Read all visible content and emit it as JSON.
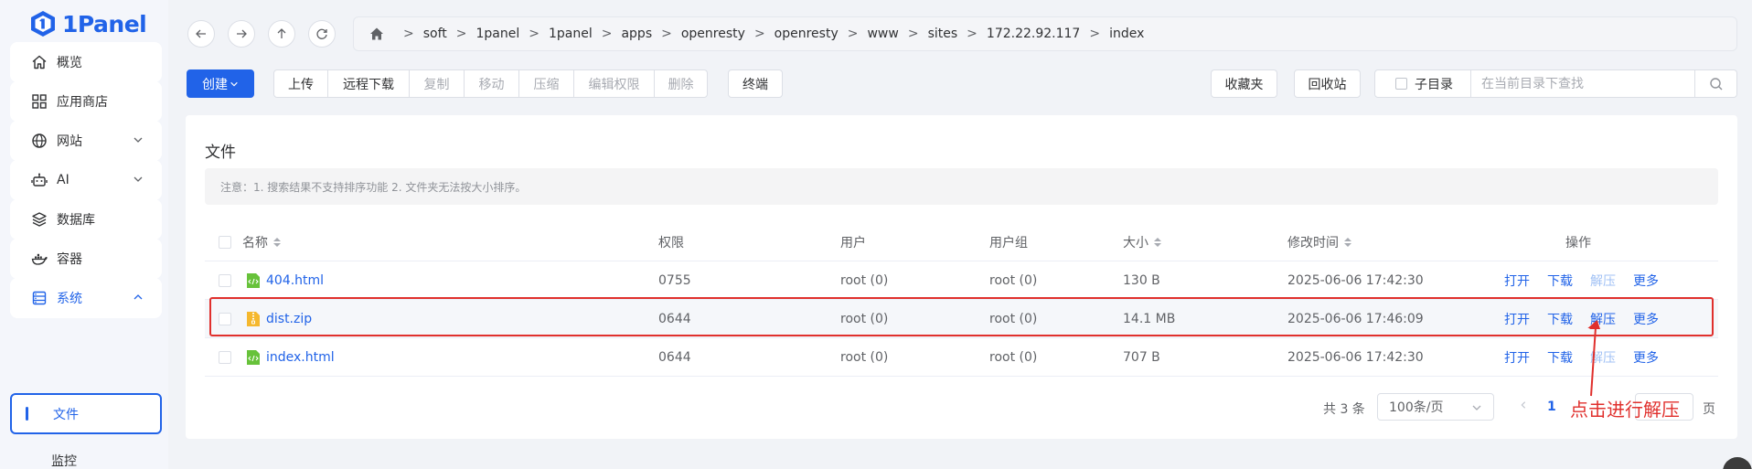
{
  "app": {
    "name": "1Panel",
    "brand_color": "#2163e8"
  },
  "sidebar": {
    "items": [
      {
        "label": "概览",
        "icon": "home-icon"
      },
      {
        "label": "应用商店",
        "icon": "grid-icon"
      },
      {
        "label": "网站",
        "icon": "globe-icon",
        "expandable": true
      },
      {
        "label": "AI",
        "icon": "robot-icon",
        "expandable": true
      },
      {
        "label": "数据库",
        "icon": "layers-icon"
      },
      {
        "label": "容器",
        "icon": "docker-icon"
      },
      {
        "label": "系统",
        "icon": "system-icon",
        "expanded": true
      }
    ],
    "sub_items": [
      {
        "label": "文件",
        "active": true
      },
      {
        "label": "监控"
      }
    ]
  },
  "breadcrumb": {
    "segments": [
      "soft",
      "1panel",
      "1panel",
      "apps",
      "openresty",
      "openresty",
      "www",
      "sites",
      "172.22.92.117",
      "index"
    ]
  },
  "toolbar": {
    "create": "创建",
    "upload": "上传",
    "remote_download": "远程下载",
    "copy": "复制",
    "move": "移动",
    "compress": "压缩",
    "edit_permission": "编辑权限",
    "delete": "删除",
    "terminal": "终端",
    "favorites": "收藏夹",
    "recycle_bin": "回收站",
    "subdir": "子目录",
    "search_placeholder": "在当前目录下查找"
  },
  "card": {
    "title": "文件",
    "notice": "注意：1. 搜索结果不支持排序功能 2. 文件夹无法按大小排序。"
  },
  "table": {
    "headers": {
      "name": "名称",
      "permission": "权限",
      "user": "用户",
      "group": "用户组",
      "size": "大小",
      "mtime": "修改时间",
      "actions": "操作"
    },
    "actions": {
      "open": "打开",
      "download": "下载",
      "decompress": "解压",
      "more": "更多"
    },
    "rows": [
      {
        "name": "404.html",
        "type": "html",
        "permission": "0755",
        "user": "root (0)",
        "group": "root (0)",
        "size": "130 B",
        "mtime": "2025-06-06 17:42:30"
      },
      {
        "name": "dist.zip",
        "type": "zip",
        "permission": "0644",
        "user": "root (0)",
        "group": "root (0)",
        "size": "14.1 MB",
        "mtime": "2025-06-06 17:46:09"
      },
      {
        "name": "index.html",
        "type": "html",
        "permission": "0644",
        "user": "root (0)",
        "group": "root (0)",
        "size": "707 B",
        "mtime": "2025-06-06 17:42:30"
      }
    ]
  },
  "pagination": {
    "total": "共 3 条",
    "page_size": "100条/页",
    "current_page": "1",
    "page_suffix": "页"
  },
  "annotation": {
    "text": "点击进行解压",
    "color": "#e0302d"
  }
}
